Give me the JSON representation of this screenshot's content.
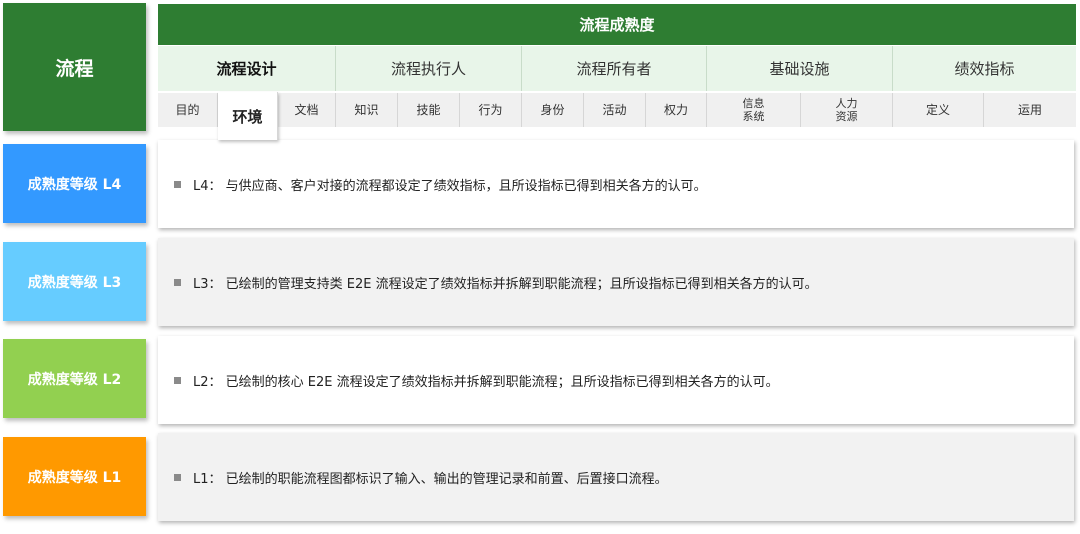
{
  "side_title": "流程",
  "header_title": "流程成熟度",
  "categories": [
    {
      "label": "流程设计"
    },
    {
      "label": "流程执行人"
    },
    {
      "label": "流程所有者"
    },
    {
      "label": "基础设施"
    },
    {
      "label": "绩效指标"
    }
  ],
  "subitems": [
    {
      "label": "目的"
    },
    {
      "label": "环境"
    },
    {
      "label": "文档"
    },
    {
      "label": "知识"
    },
    {
      "label": "技能"
    },
    {
      "label": "行为"
    },
    {
      "label": "身份"
    },
    {
      "label": "活动"
    },
    {
      "label": "权力"
    },
    {
      "label": "信息\n系统"
    },
    {
      "label": "人力\n资源"
    },
    {
      "label": "定义"
    },
    {
      "label": "运用"
    }
  ],
  "highlighted_subitem": "环境",
  "levels": [
    {
      "label": "成熟度等级 L4",
      "color": "#3399ff",
      "text": "L4： 与供应商、客户对接的流程都设定了绩效指标，且所设指标已得到相关各方的认可。"
    },
    {
      "label": "成熟度等级 L3",
      "color": "#66ccff",
      "text": "L3： 已绘制的管理支持类 E2E 流程设定了绩效指标并拆解到职能流程；且所设指标已得到相关各方的认可。"
    },
    {
      "label": "成熟度等级 L2",
      "color": "#92d050",
      "text": "L2： 已绘制的核心 E2E 流程设定了绩效指标并拆解到职能流程；且所设指标已得到相关各方的认可。"
    },
    {
      "label": "成熟度等级 L1",
      "color": "#ff9900",
      "text": "L1： 已绘制的职能流程图都标识了输入、输出的管理记录和前置、后置接口流程。"
    }
  ],
  "colors": {
    "header_green": "#2e7d32",
    "category_bg": "#e8f5e9"
  }
}
